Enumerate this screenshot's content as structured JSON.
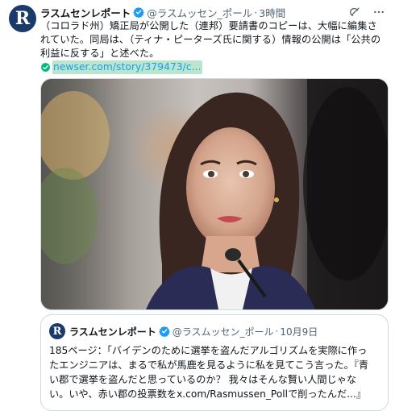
{
  "author": {
    "avatar_letter": "R",
    "name": "ラスムセンレポート",
    "handle": "@ラスムッセン_ポール",
    "time": "3時間"
  },
  "tweet": {
    "lines": [
      "（コロラド州）矯正局が公開した（連邦）要請書のコピーは、大幅に編集さ",
      "れていた。同局は、（ティナ・ピーターズ氏に関する）情報の公開は「公共の",
      "利益に反する」と述べた。"
    ],
    "link_text": "newser.com/story/379473/c..."
  },
  "quoted": {
    "avatar_letter": "R",
    "name": "ラスムセンレポート",
    "handle": "@ラスムッセン_ポール",
    "date": "10月9日",
    "lines": [
      "185ページ：「バイデンのために選挙を盗んだアルゴリズムを実際に作っ",
      "たエンジニアは、まるで私が馬鹿を見るように私を見てこう言った。『青",
      "い郡で選挙を盗んだと思っているのか？ 我々はそんな賢い人間じゃな",
      "い。いや、赤い郡の投票数をx.com/Rasmussen_Pollで削ったんだ...』"
    ]
  },
  "colors": {
    "link": "#1d9bf0",
    "link_highlight": "#b9e6cc",
    "verified": "#1d9bf0",
    "muted": "#536471",
    "avatar_bg": "#1a3a6b"
  },
  "icons": {
    "verified": "verified-badge-icon",
    "grok": "grok-icon",
    "more": "more-icon",
    "link": "link-check-icon"
  }
}
